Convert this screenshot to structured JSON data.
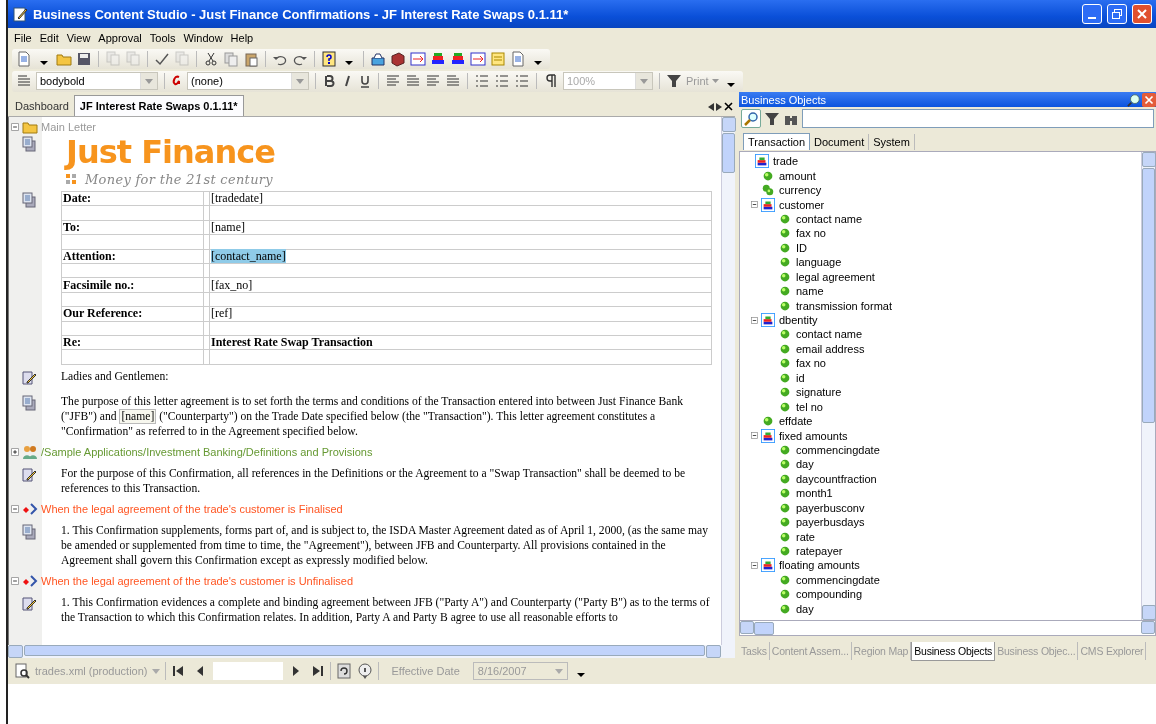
{
  "window": {
    "title": "Business Content Studio - Just Finance Confirmations - JF Interest Rate Swaps 0.1.11*"
  },
  "menu": [
    "File",
    "Edit",
    "View",
    "Approval",
    "Tools",
    "Window",
    "Help"
  ],
  "format_bar": {
    "paragraph_style": "bodybold",
    "character_style": "(none)",
    "zoom": "100%",
    "print": "Print"
  },
  "doc_tabs": [
    {
      "label": "Dashboard",
      "selected": false
    },
    {
      "label": "JF Interest Rate Swaps 0.1.11*",
      "selected": true
    }
  ],
  "document": {
    "section": {
      "label": "Main Letter",
      "expanded": true
    },
    "logo": {
      "name": "Just Finance",
      "tagline": "Money for the 21st century"
    },
    "fields": [
      {
        "label": "Date:",
        "value": "[tradedate]",
        "highlighted": false,
        "bold": false
      },
      {
        "label": "To:",
        "value": "[name]",
        "highlighted": false,
        "bold": false
      },
      {
        "label": "Attention:",
        "value": "[contact_name]",
        "highlighted": true,
        "bold": false
      },
      {
        "label": "Facsimile no.:",
        "value": "[fax_no]",
        "highlighted": false,
        "bold": false
      },
      {
        "label": "Our Reference:",
        "value": "[ref]",
        "highlighted": false,
        "bold": false
      },
      {
        "label": "Re:",
        "value": "Interest Rate Swap Transaction",
        "highlighted": false,
        "bold": true
      }
    ],
    "blocks": [
      {
        "kind": "paragraph",
        "editable": true,
        "segments": [
          {
            "text": "Ladies and Gentlemen:",
            "field": false
          }
        ]
      },
      {
        "kind": "paragraph",
        "editable": false,
        "segments": [
          {
            "text": "The purpose of this letter agreement is to set forth the terms and conditions of the Transaction entered into between Just Finance Bank (\"JFB\") and ",
            "field": false
          },
          {
            "text": "[name]",
            "field": true
          },
          {
            "text": " (\"Counterparty\") on the Trade Date specified below (the \"Transaction\"). This letter agreement constitutes a \"Confirmation\" as referred to in the Agreement specified below.",
            "field": false
          }
        ]
      },
      {
        "kind": "include",
        "expanded": false,
        "color": "#669933",
        "text": "/Sample Applications/Investment Banking/Definitions and Provisions"
      },
      {
        "kind": "paragraph",
        "editable": true,
        "segments": [
          {
            "text": "For the purpose of this Confirmation, all references in the Definitions or the Agreement to a \"Swap Transaction\" shall be deemed to be references to this Transaction.",
            "field": false
          }
        ]
      },
      {
        "kind": "condition",
        "expanded": true,
        "color": "#ff5522",
        "text": "When the legal agreement of the trade's customer is Finalised"
      },
      {
        "kind": "paragraph",
        "editable": false,
        "segments": [
          {
            "text": "1. This Confirmation supplements, forms part of, and is subject to, the ISDA Master Agreement dated as of April 1, 2000, (as the same may be amended or supplemented from time to time, the \"Agreement\"), between JFB and Counterparty. All provisions contained in the Agreement shall govern this Confirmation except as expressly modified below.",
            "field": false
          }
        ]
      },
      {
        "kind": "condition",
        "expanded": true,
        "color": "#ff5522",
        "text": "When the legal agreement of the trade's customer is Unfinalised"
      },
      {
        "kind": "paragraph",
        "editable": true,
        "segments": [
          {
            "text": "1. This Confirmation evidences a complete and binding agreement between JFB (\"Party A\") and Counterparty (\"Party B\") as to the terms of the Transaction to which this Confirmation relates. In addition, Party A and Party B agree to use all reasonable efforts to",
            "field": false
          }
        ]
      }
    ]
  },
  "objects_panel": {
    "title": "Business Objects",
    "tabs": [
      {
        "label": "Transaction",
        "selected": true
      },
      {
        "label": "Document",
        "selected": false
      },
      {
        "label": "System",
        "selected": false
      }
    ],
    "tree": [
      {
        "label": "trade",
        "kind": "object",
        "children": [
          {
            "label": "amount",
            "kind": "attribute"
          },
          {
            "label": "currency",
            "kind": "collection"
          },
          {
            "label": "customer",
            "kind": "object",
            "expanded": true,
            "children": [
              {
                "label": "contact name",
                "kind": "attribute"
              },
              {
                "label": "fax no",
                "kind": "attribute"
              },
              {
                "label": "ID",
                "kind": "attribute"
              },
              {
                "label": "language",
                "kind": "attribute"
              },
              {
                "label": "legal agreement",
                "kind": "attribute"
              },
              {
                "label": "name",
                "kind": "attribute"
              },
              {
                "label": "transmission format",
                "kind": "attribute"
              }
            ]
          },
          {
            "label": "dbentity",
            "kind": "object",
            "expanded": true,
            "children": [
              {
                "label": "contact name",
                "kind": "attribute"
              },
              {
                "label": "email address",
                "kind": "attribute"
              },
              {
                "label": "fax no",
                "kind": "attribute"
              },
              {
                "label": "id",
                "kind": "attribute"
              },
              {
                "label": "signature",
                "kind": "attribute"
              },
              {
                "label": "tel no",
                "kind": "attribute"
              }
            ]
          },
          {
            "label": "effdate",
            "kind": "attribute"
          },
          {
            "label": "fixed amounts",
            "kind": "object",
            "expanded": true,
            "children": [
              {
                "label": "commencingdate",
                "kind": "attribute"
              },
              {
                "label": "day",
                "kind": "attribute"
              },
              {
                "label": "daycountfraction",
                "kind": "attribute"
              },
              {
                "label": "month1",
                "kind": "attribute"
              },
              {
                "label": "payerbusconv",
                "kind": "attribute"
              },
              {
                "label": "payerbusdays",
                "kind": "attribute"
              },
              {
                "label": "rate",
                "kind": "attribute"
              },
              {
                "label": "ratepayer",
                "kind": "attribute"
              }
            ]
          },
          {
            "label": "floating amounts",
            "kind": "object",
            "expanded": true,
            "children": [
              {
                "label": "commencingdate",
                "kind": "attribute"
              },
              {
                "label": "compounding",
                "kind": "attribute"
              },
              {
                "label": "day",
                "kind": "attribute"
              }
            ]
          }
        ]
      }
    ]
  },
  "bottom_tabs": [
    {
      "label": "Tasks",
      "selected": false
    },
    {
      "label": "Content Assem...",
      "selected": false
    },
    {
      "label": "Region Map",
      "selected": false
    },
    {
      "label": "Business Objects",
      "selected": true
    },
    {
      "label": "Business Objec...",
      "selected": false
    },
    {
      "label": "CMS Explorer",
      "selected": false
    }
  ],
  "nav_bar": {
    "source": "trades.xml (production)",
    "date_label": "Effective Date",
    "date": "8/16/2007"
  }
}
